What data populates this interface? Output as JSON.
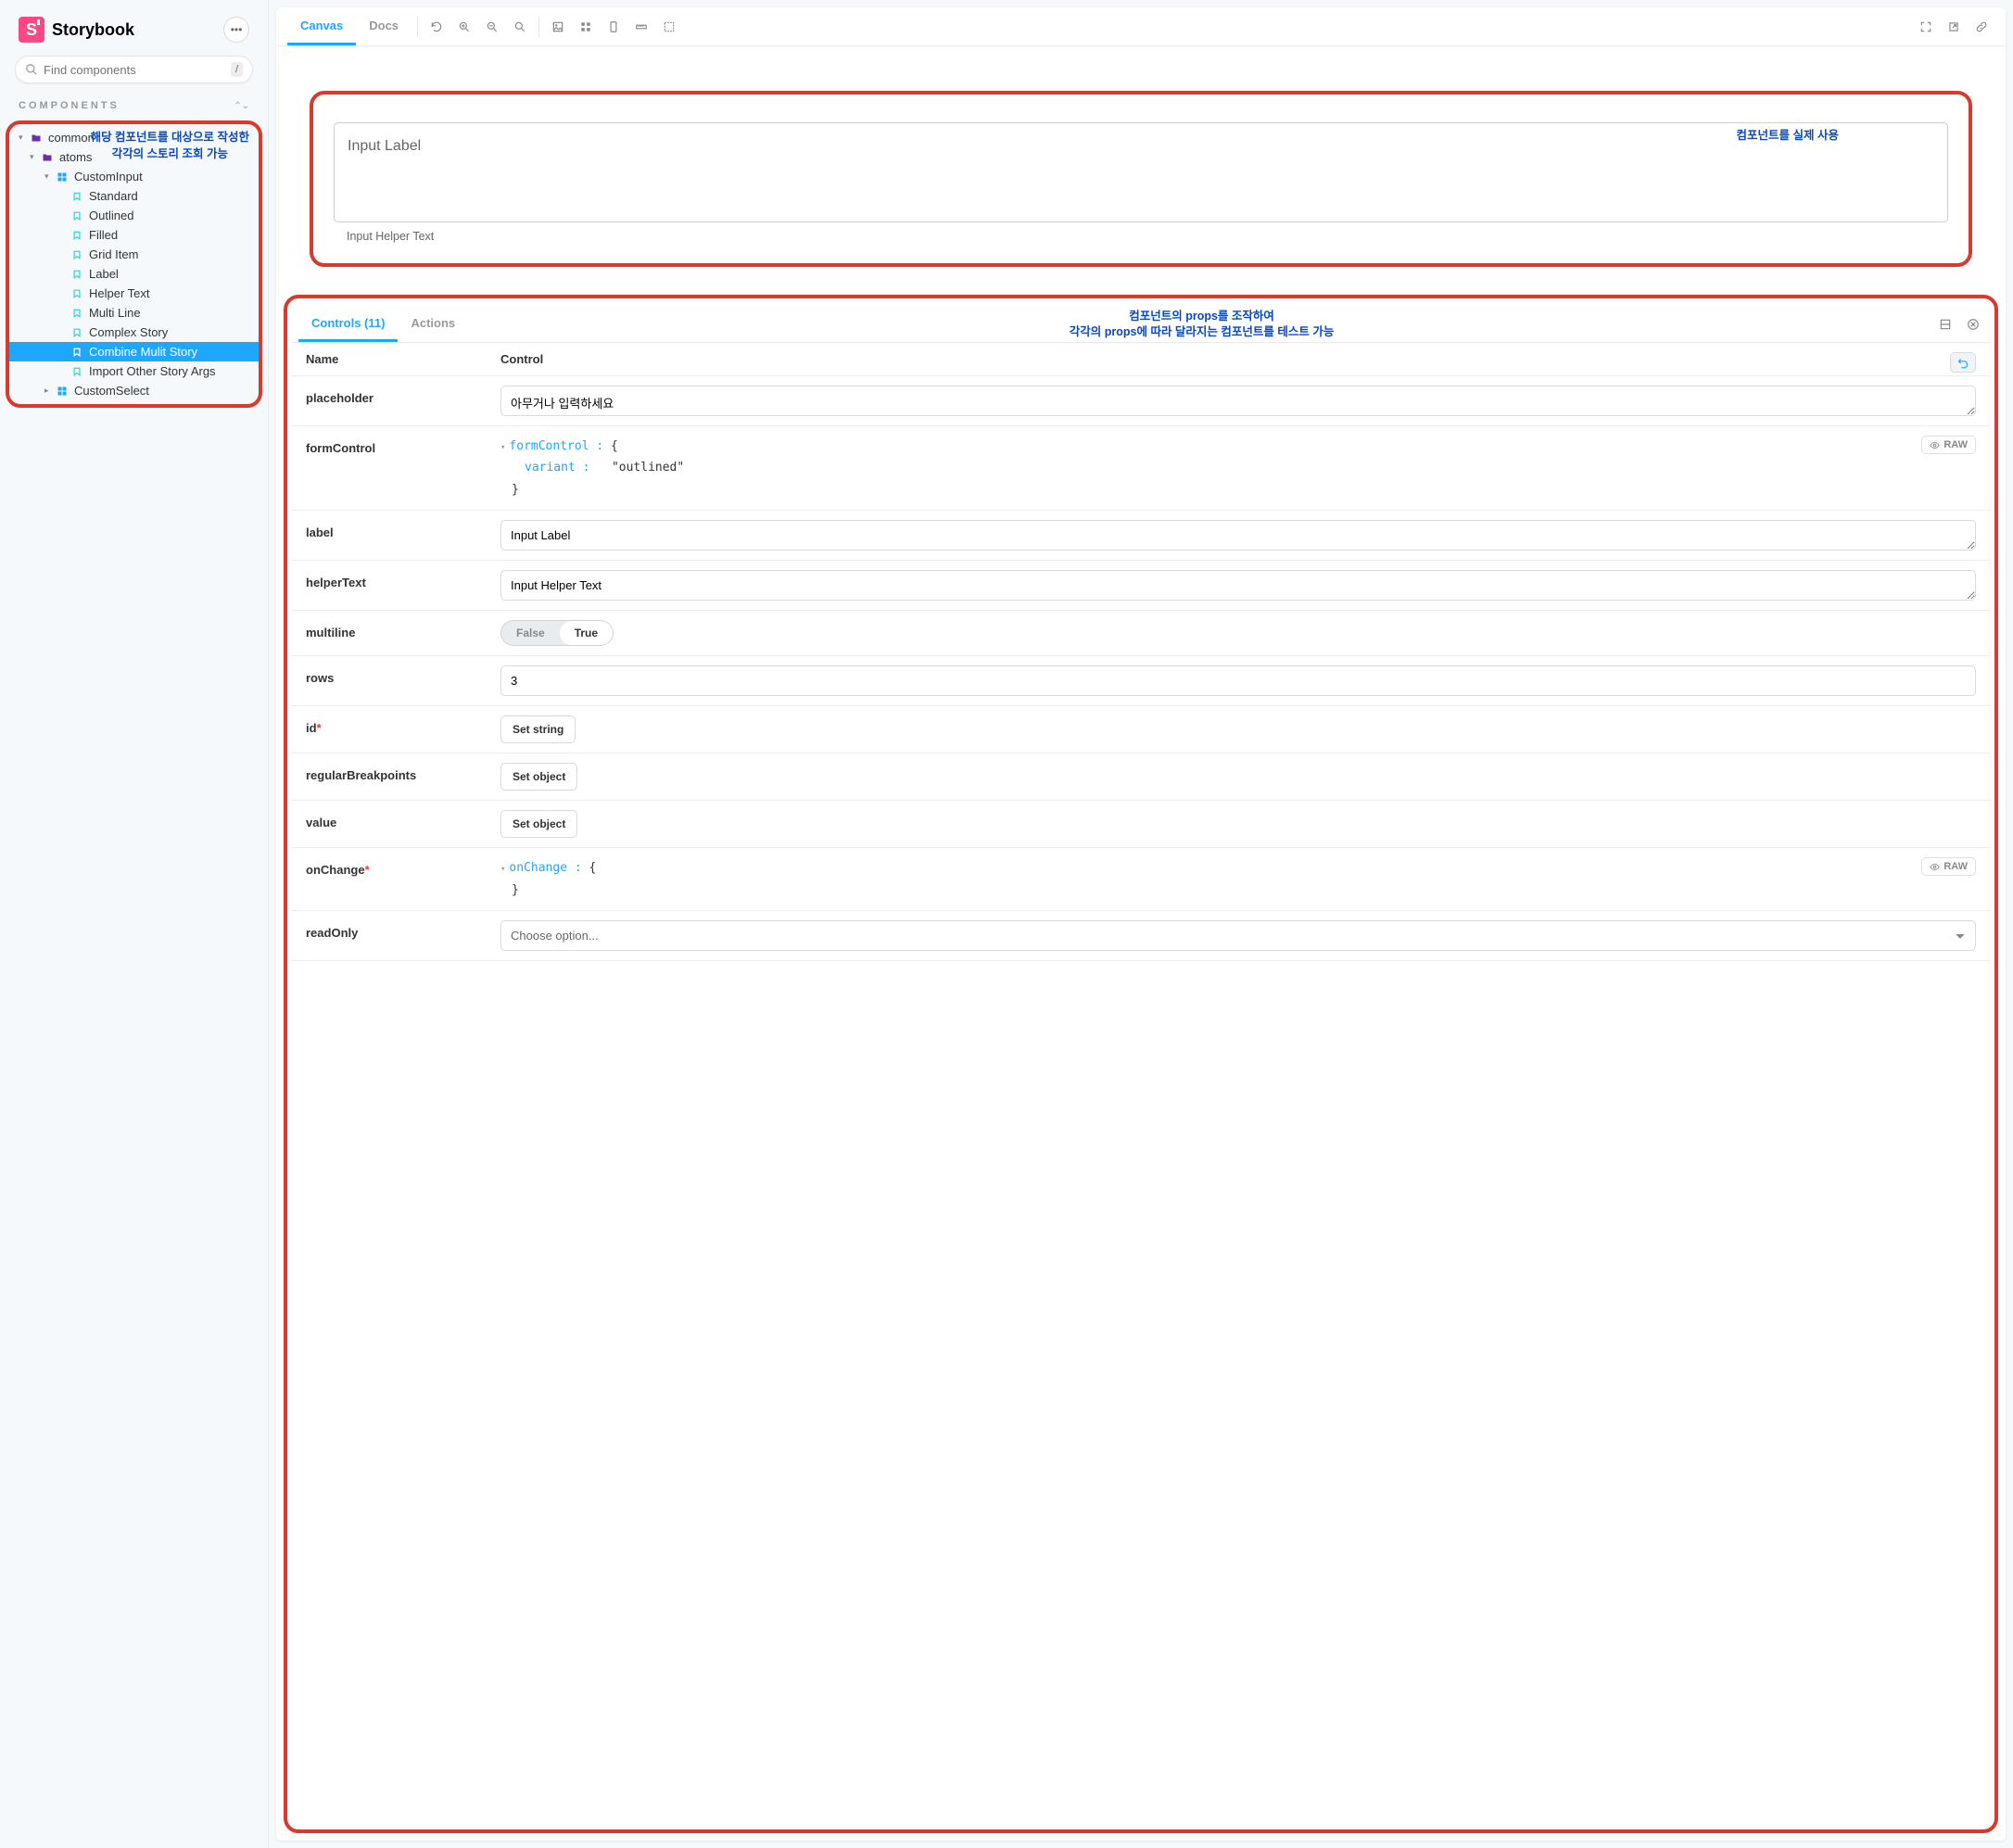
{
  "brand": "Storybook",
  "search": {
    "placeholder": "Find components",
    "key": "/"
  },
  "sectionLabel": "COMPONENTS",
  "annotations": {
    "sidebar_line1": "해당 컴포넌트를 대상으로 작성한",
    "sidebar_line2": "각각의 스토리 조회 가능",
    "canvas": "컴포넌트를 실제 사용",
    "addons_line1": "컴포넌트의 props를 조작하여",
    "addons_line2": "각각의 props에 따라 달라지는 컴포넌트를 테스트 가능"
  },
  "tree": {
    "root": "common",
    "atoms": "atoms",
    "customInput": "CustomInput",
    "stories": [
      "Standard",
      "Outlined",
      "Filled",
      "Grid Item",
      "Label",
      "Helper Text",
      "Multi Line",
      "Complex Story",
      "Combine Mulit Story",
      "Import Other Story Args"
    ],
    "customSelect": "CustomSelect"
  },
  "toolbar": {
    "tabs": {
      "canvas": "Canvas",
      "docs": "Docs"
    }
  },
  "demo": {
    "label": "Input Label",
    "helper": "Input Helper Text"
  },
  "addons": {
    "controlsTab": "Controls (11)",
    "actionsTab": "Actions",
    "headers": {
      "name": "Name",
      "control": "Control"
    },
    "rows": {
      "placeholder": {
        "name": "placeholder",
        "value": "아무거나 입력하세요"
      },
      "formControl": {
        "name": "formControl",
        "key": "formControl",
        "brace": "{",
        "variantKey": "variant",
        "variantVal": "\"outlined\"",
        "close": "}",
        "raw": "RAW"
      },
      "label": {
        "name": "label",
        "value": "Input Label"
      },
      "helperText": {
        "name": "helperText",
        "value": "Input Helper Text"
      },
      "multiline": {
        "name": "multiline",
        "false": "False",
        "true": "True"
      },
      "rows": {
        "name": "rows",
        "value": "3"
      },
      "id": {
        "name": "id",
        "button": "Set string"
      },
      "regularBreakpoints": {
        "name": "regularBreakpoints",
        "button": "Set object"
      },
      "value": {
        "name": "value",
        "button": "Set object"
      },
      "onChange": {
        "name": "onChange",
        "key": "onChange",
        "brace": "{",
        "close": "}",
        "raw": "RAW"
      },
      "readOnly": {
        "name": "readOnly",
        "placeholder": "Choose option..."
      }
    }
  }
}
